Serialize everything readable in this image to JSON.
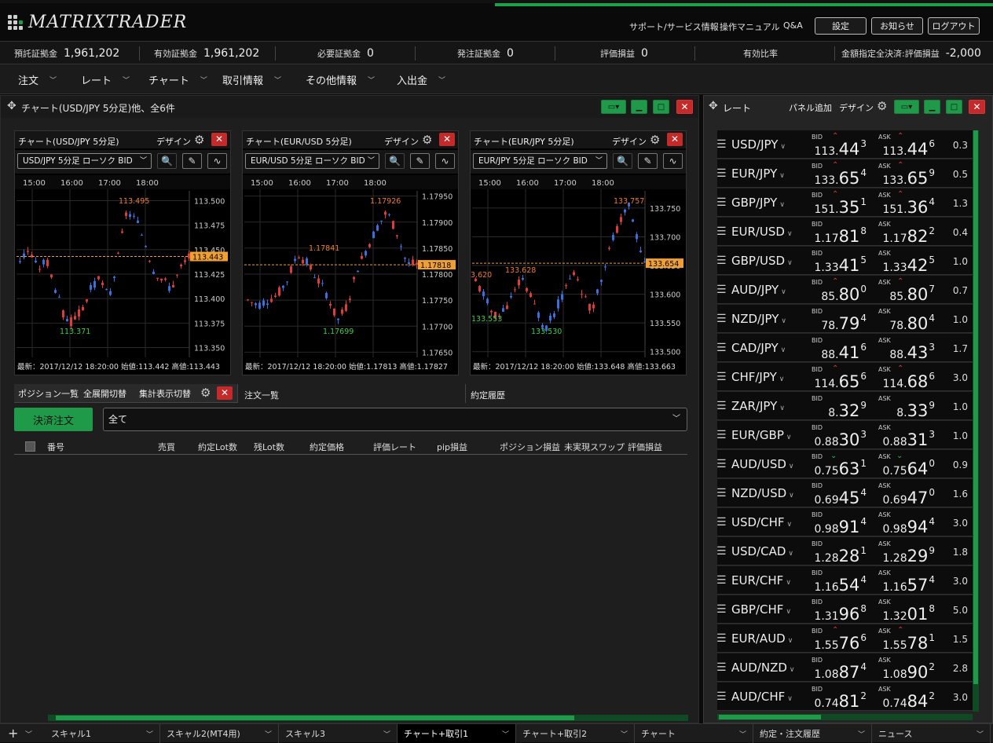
{
  "app": {
    "logo": "MATRIXTRADER"
  },
  "header": {
    "links": [
      "サポート/サービス情報",
      "操作マニュアル",
      "Q&A"
    ],
    "buttons": [
      "設定",
      "お知らせ",
      "ログアウト"
    ]
  },
  "account": {
    "deposit_label": "預託証拠金",
    "deposit_value": "1,961,202",
    "effective_label": "有効証拠金",
    "effective_value": "1,961,202",
    "required_label": "必要証拠金",
    "required_value": "0",
    "order_label": "発注証拠金",
    "order_value": "0",
    "pl_label": "評価損益",
    "pl_value": "0",
    "ratio_label": "有効比率",
    "ratio_value": "",
    "settle_label": "金額指定全決済:評価損益",
    "settle_value": "-2,000"
  },
  "menu": [
    "注文",
    "レート",
    "チャート",
    "取引情報",
    "その他情報",
    "入出金"
  ],
  "left_panel": {
    "title": "チャート(USD/JPY 5分足)他、全6件"
  },
  "charts": [
    {
      "title": "チャート(USD/JPY 5分足)",
      "design": "デザイン",
      "select": "USD/JPY 5分足 ローソク BID",
      "times": [
        "15:00",
        "16:00",
        "17:00",
        "18:00"
      ],
      "yticks": [
        "113.500",
        "113.475",
        "113.450",
        "113.425",
        "113.400",
        "113.375",
        "113.350"
      ],
      "current": "113.443",
      "hi_label": "113.495",
      "lo_label": "113.371",
      "footer": "最新：2017/12/12 18:20:00 始値:113.442 高値:113.443"
    },
    {
      "title": "チャート(EUR/USD 5分足)",
      "design": "デザイン",
      "select": "EUR/USD 5分足 ローソク BID",
      "times": [
        "15:00",
        "16:00",
        "17:00",
        "18:00"
      ],
      "yticks": [
        "1.17950",
        "1.17900",
        "1.17850",
        "1.17800",
        "1.17750",
        "1.17700",
        "1.17650"
      ],
      "current": "1.17818",
      "hi_label": "1.17926",
      "mid_label": "1.17841",
      "lo_label": "1.17699",
      "footer": "最新：2017/12/12 18:20:00 始値:1.17813 高値:1.17827"
    },
    {
      "title": "チャート(EUR/JPY 5分足)",
      "design": "デザイン",
      "select": "EUR/JPY 5分足 ローソク BID",
      "times": [
        "15:00",
        "16:00",
        "17:00",
        "18:00"
      ],
      "yticks": [
        "133.750",
        "133.700",
        "133.650",
        "133.600",
        "133.550",
        "133.500"
      ],
      "current": "133.654",
      "hi_label": "133.757",
      "mid_label": "133.628",
      "left_label": "3.620",
      "lo_label": "133.530",
      "lo2_label": "133.553",
      "footer": "最新：2017/12/12 18:20:00 始値:133.648 高値:133.663"
    }
  ],
  "positions": {
    "tabs": [
      "ポジション一覧",
      "全展開切替",
      "集計表示切替"
    ],
    "order_tab": "注文一覧",
    "history_tab": "約定履歴",
    "close_button": "決済注文",
    "filter": "全て",
    "columns": [
      "番号",
      "売買",
      "約定Lot数",
      "残Lot数",
      "約定価格",
      "評価レート",
      "pip損益",
      "ポジション損益",
      "未実現スワップ",
      "評価損益"
    ]
  },
  "rate_panel": {
    "title": "レート",
    "add": "パネル追加",
    "design": "デザイン",
    "bid": "BID",
    "ask": "ASK"
  },
  "rates": [
    {
      "pair": "USD/JPY",
      "bid": [
        "113.",
        "44",
        "3"
      ],
      "ask": [
        "113.",
        "44",
        "6"
      ],
      "spread": "0.3",
      "dir": "up"
    },
    {
      "pair": "EUR/JPY",
      "bid": [
        "133.",
        "65",
        "4"
      ],
      "ask": [
        "133.",
        "65",
        "9"
      ],
      "spread": "0.5",
      "dir": "up"
    },
    {
      "pair": "GBP/JPY",
      "bid": [
        "151.",
        "35",
        "1"
      ],
      "ask": [
        "151.",
        "36",
        "4"
      ],
      "spread": "1.3",
      "dir": "up"
    },
    {
      "pair": "EUR/USD",
      "bid": [
        "1.17",
        "81",
        "8"
      ],
      "ask": [
        "1.17",
        "82",
        "2"
      ],
      "spread": "0.4",
      "dir": ""
    },
    {
      "pair": "GBP/USD",
      "bid": [
        "1.33",
        "41",
        "5"
      ],
      "ask": [
        "1.33",
        "42",
        "5"
      ],
      "spread": "1.0",
      "dir": ""
    },
    {
      "pair": "AUD/JPY",
      "bid": [
        "85.",
        "80",
        "0"
      ],
      "ask": [
        "85.",
        "80",
        "7"
      ],
      "spread": "0.7",
      "dir": "up"
    },
    {
      "pair": "NZD/JPY",
      "bid": [
        "78.",
        "79",
        "4"
      ],
      "ask": [
        "78.",
        "80",
        "4"
      ],
      "spread": "1.0",
      "dir": ""
    },
    {
      "pair": "CAD/JPY",
      "bid": [
        "88.",
        "41",
        "6"
      ],
      "ask": [
        "88.",
        "43",
        "3"
      ],
      "spread": "1.7",
      "dir": ""
    },
    {
      "pair": "CHF/JPY",
      "bid": [
        "114.",
        "65",
        "6"
      ],
      "ask": [
        "114.",
        "68",
        "6"
      ],
      "spread": "3.0",
      "dir": "up"
    },
    {
      "pair": "ZAR/JPY",
      "bid": [
        "8.",
        "32",
        "9"
      ],
      "ask": [
        "8.",
        "33",
        "9"
      ],
      "spread": "1.0",
      "dir": ""
    },
    {
      "pair": "EUR/GBP",
      "bid": [
        "0.88",
        "30",
        "3"
      ],
      "ask": [
        "0.88",
        "31",
        "3"
      ],
      "spread": "1.0",
      "dir": ""
    },
    {
      "pair": "AUD/USD",
      "bid": [
        "0.75",
        "63",
        "1"
      ],
      "ask": [
        "0.75",
        "64",
        "0"
      ],
      "spread": "0.9",
      "dir": "down"
    },
    {
      "pair": "NZD/USD",
      "bid": [
        "0.69",
        "45",
        "4"
      ],
      "ask": [
        "0.69",
        "47",
        "0"
      ],
      "spread": "1.6",
      "dir": ""
    },
    {
      "pair": "USD/CHF",
      "bid": [
        "0.98",
        "91",
        "4"
      ],
      "ask": [
        "0.98",
        "94",
        "4"
      ],
      "spread": "3.0",
      "dir": ""
    },
    {
      "pair": "USD/CAD",
      "bid": [
        "1.28",
        "28",
        "1"
      ],
      "ask": [
        "1.28",
        "29",
        "9"
      ],
      "spread": "1.8",
      "dir": ""
    },
    {
      "pair": "EUR/CHF",
      "bid": [
        "1.16",
        "54",
        "4"
      ],
      "ask": [
        "1.16",
        "57",
        "4"
      ],
      "spread": "3.0",
      "dir": ""
    },
    {
      "pair": "GBP/CHF",
      "bid": [
        "1.31",
        "96",
        "8"
      ],
      "ask": [
        "1.32",
        "01",
        "8"
      ],
      "spread": "5.0",
      "dir": ""
    },
    {
      "pair": "EUR/AUD",
      "bid": [
        "1.55",
        "76",
        "6"
      ],
      "ask": [
        "1.55",
        "78",
        "1"
      ],
      "spread": "1.5",
      "dir": "up"
    },
    {
      "pair": "AUD/NZD",
      "bid": [
        "1.08",
        "87",
        "4"
      ],
      "ask": [
        "1.08",
        "90",
        "2"
      ],
      "spread": "2.8",
      "dir": ""
    },
    {
      "pair": "AUD/CHF",
      "bid": [
        "0.74",
        "81",
        "2"
      ],
      "ask": [
        "0.74",
        "84",
        "2"
      ],
      "spread": "3.0",
      "dir": ""
    }
  ],
  "bottom_tabs": [
    "スキャル1",
    "スキャル2(MT4用)",
    "スキャル3",
    "チャート+取引1",
    "チャート+取引2",
    "チャート",
    "約定・注文履歴",
    "ニュース"
  ],
  "colors": {
    "accent": "#1f9a49",
    "close": "#c42a2a",
    "up": "#e03a3a",
    "down": "#3a6fe0",
    "price_line": "#f0a030"
  }
}
